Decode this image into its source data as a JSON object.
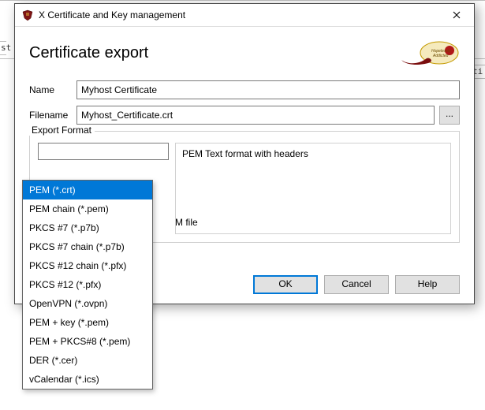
{
  "background": {
    "left_fragment": "st",
    "right_fragment": "ti"
  },
  "window": {
    "title": "X Certificate and Key management"
  },
  "header": {
    "title": "Certificate export"
  },
  "form": {
    "name_label": "Name",
    "name_value": "Myhost Certificate",
    "filename_label": "Filename",
    "filename_value": "Myhost_Certificate.crt",
    "browse_label": "..."
  },
  "group": {
    "label": "Export Format",
    "description": "PEM Text format with headers",
    "hidden_text": "M file"
  },
  "dropdown": {
    "items": [
      "PEM (*.crt)",
      "PEM chain (*.pem)",
      "PKCS #7 (*.p7b)",
      "PKCS #7 chain (*.p7b)",
      "PKCS #12 chain (*.pfx)",
      "PKCS #12 (*.pfx)",
      "OpenVPN (*.ovpn)",
      "PEM + key (*.pem)",
      "PEM + PKCS#8 (*.pem)",
      "DER (*.cer)",
      "vCalendar (*.ics)"
    ]
  },
  "buttons": {
    "ok": "OK",
    "cancel": "Cancel",
    "help": "Help"
  }
}
